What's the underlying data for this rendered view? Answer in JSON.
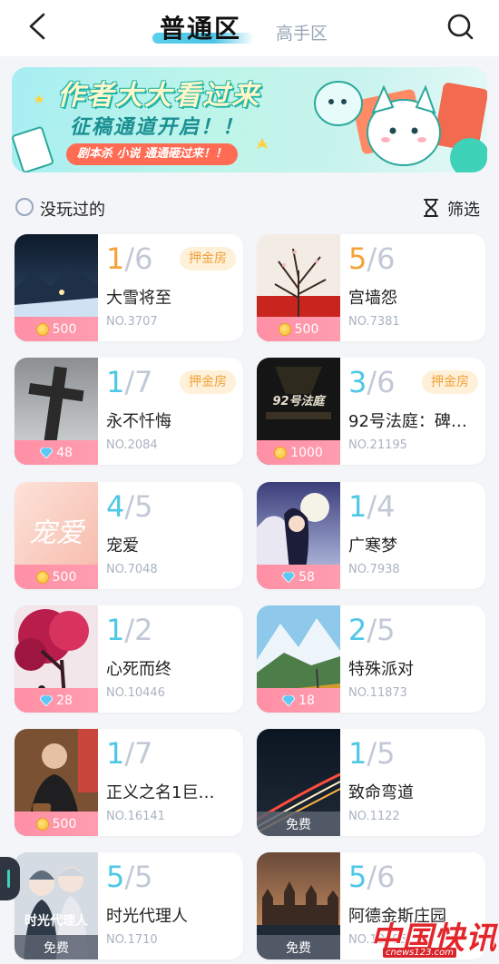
{
  "header": {
    "tab_active": "普通区",
    "tab_inactive": "高手区"
  },
  "banner": {
    "title": "作者大大看过来",
    "subtitle": "征稿通道开启！！",
    "pill": "剧本杀  小说  通通砸过来！！"
  },
  "filter": {
    "unplayed_label": "没玩过的",
    "filter_label": "筛选"
  },
  "rooms": [
    {
      "current": "1",
      "max": "6",
      "name": "大雪将至",
      "no": "NO.3707",
      "price": "500",
      "currency": "coin-icon",
      "deposit": "押金房",
      "cur_color": "orange"
    },
    {
      "current": "5",
      "max": "6",
      "name": "宫墙怨",
      "no": "NO.7381",
      "price": "500",
      "currency": "coin-icon",
      "deposit": "",
      "cur_color": "orange"
    },
    {
      "current": "1",
      "max": "7",
      "name": "永不忏悔",
      "no": "NO.2084",
      "price": "48",
      "currency": "diamond-icon",
      "deposit": "押金房",
      "cur_color": "teal"
    },
    {
      "current": "3",
      "max": "6",
      "name": "92号法庭：碑…",
      "no": "NO.21195",
      "price": "1000",
      "currency": "coin-icon",
      "deposit": "押金房",
      "cur_color": "teal"
    },
    {
      "current": "4",
      "max": "5",
      "name": "宠爱",
      "no": "NO.7048",
      "price": "500",
      "currency": "coin-icon",
      "deposit": "",
      "cur_color": "teal"
    },
    {
      "current": "1",
      "max": "4",
      "name": "广寒梦",
      "no": "NO.7938",
      "price": "58",
      "currency": "diamond-icon",
      "deposit": "",
      "cur_color": "teal"
    },
    {
      "current": "1",
      "max": "2",
      "name": "心死而终",
      "no": "NO.10446",
      "price": "28",
      "currency": "diamond-icon",
      "deposit": "",
      "cur_color": "teal"
    },
    {
      "current": "2",
      "max": "5",
      "name": "特殊派对",
      "no": "NO.11873",
      "price": "18",
      "currency": "diamond-icon",
      "deposit": "",
      "cur_color": "teal"
    },
    {
      "current": "1",
      "max": "7",
      "name": "正义之名1巨…",
      "no": "NO.16141",
      "price": "500",
      "currency": "coin-icon",
      "deposit": "",
      "cur_color": "teal"
    },
    {
      "current": "1",
      "max": "5",
      "name": "致命弯道",
      "no": "NO.1122",
      "price": "免费",
      "currency": "free",
      "deposit": "",
      "cur_color": "teal"
    },
    {
      "current": "5",
      "max": "5",
      "name": "时光代理人",
      "no": "NO.1710",
      "price": "免费",
      "currency": "free",
      "deposit": "",
      "cur_color": "teal"
    },
    {
      "current": "5",
      "max": "6",
      "name": "阿德金斯庄园",
      "no": "NO.13095",
      "price": "免费",
      "currency": "free",
      "deposit": "",
      "cur_color": "teal"
    }
  ],
  "thumb_text": {
    "court": "92号法庭",
    "love": "宠爱",
    "timeagent": "时光代理人"
  },
  "watermark": {
    "text": "中国快讯",
    "url": "cnews123.com"
  }
}
